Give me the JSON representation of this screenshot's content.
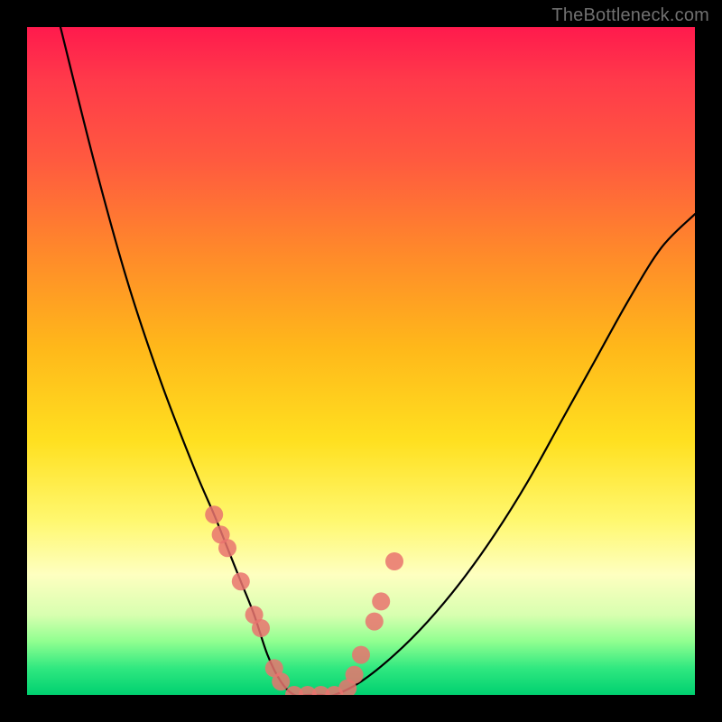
{
  "watermark": "TheBottleneck.com",
  "chart_data": {
    "type": "line",
    "title": "",
    "xlabel": "",
    "ylabel": "",
    "xlim": [
      0,
      100
    ],
    "ylim": [
      0,
      100
    ],
    "series": [
      {
        "name": "bottleneck-curve",
        "x": [
          5,
          10,
          15,
          20,
          25,
          28,
          30,
          32,
          34,
          36,
          38,
          40,
          42,
          44,
          46,
          50,
          55,
          60,
          65,
          70,
          75,
          80,
          85,
          90,
          95,
          100
        ],
        "y": [
          100,
          80,
          62,
          47,
          34,
          27,
          22,
          17,
          12,
          6,
          2,
          0,
          0,
          0,
          0,
          2,
          6,
          11,
          17,
          24,
          32,
          41,
          50,
          59,
          67,
          72
        ]
      }
    ],
    "markers": {
      "name": "highlight-points",
      "x": [
        28,
        29,
        30,
        32,
        34,
        35,
        37,
        38,
        40,
        42,
        44,
        46,
        48,
        49,
        50,
        52,
        53,
        55
      ],
      "y": [
        27,
        24,
        22,
        17,
        12,
        10,
        4,
        2,
        0,
        0,
        0,
        0,
        1,
        3,
        6,
        11,
        14,
        20
      ]
    },
    "gradient_stops": [
      {
        "pos": 0,
        "color": "#ff1a4d"
      },
      {
        "pos": 20,
        "color": "#ff5a3f"
      },
      {
        "pos": 48,
        "color": "#ffb81a"
      },
      {
        "pos": 74,
        "color": "#fff870"
      },
      {
        "pos": 92,
        "color": "#90ff90"
      },
      {
        "pos": 100,
        "color": "#00d070"
      }
    ]
  }
}
